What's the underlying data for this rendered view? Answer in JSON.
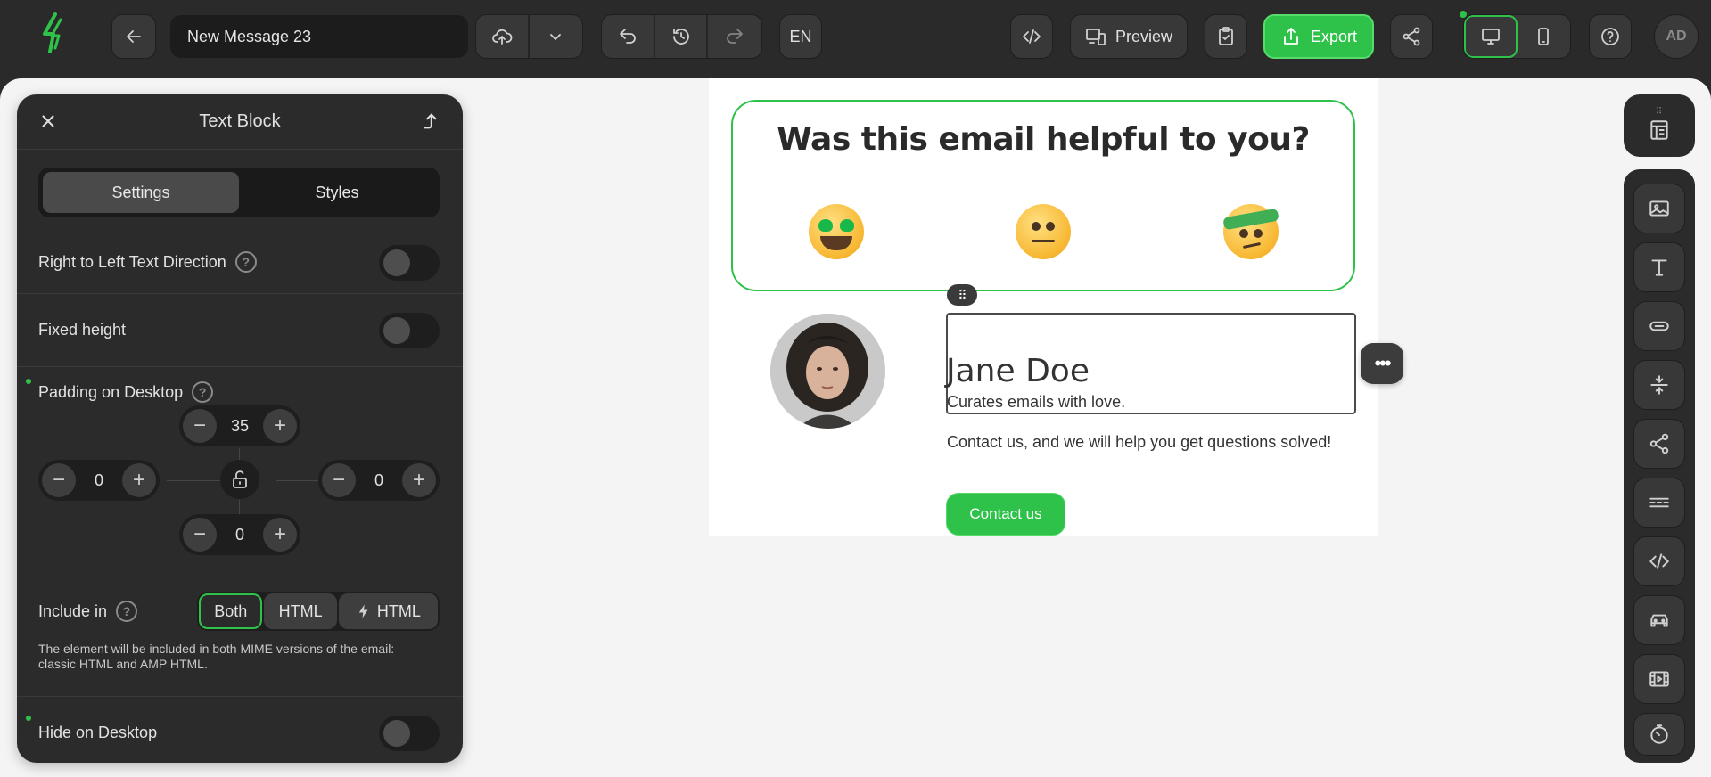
{
  "toolbar": {
    "message_title": "New Message 23",
    "language": "EN",
    "preview_label": "Preview",
    "export_label": "Export",
    "user_initials": "AD"
  },
  "panel": {
    "title": "Text Block",
    "tabs": [
      "Settings",
      "Styles"
    ],
    "active_tab": "Settings",
    "rtl_label": "Right to Left Text Direction",
    "fixed_height_label": "Fixed height",
    "padding_label": "Padding on Desktop",
    "padding": {
      "top": "35",
      "left": "0",
      "right": "0",
      "bottom": "0"
    },
    "include_label": "Include in",
    "include_options": [
      "Both",
      "HTML",
      "HTML"
    ],
    "include_selected": "Both",
    "include_note": "The element will be included in both MIME versions of the email: classic HTML and AMP HTML.",
    "hide_desktop_label": "Hide on Desktop"
  },
  "email": {
    "question": "Was this email helpful to you?",
    "name": "Jane Doe",
    "tagline": "Curates emails with love.",
    "contact_text": "Contact us, and we will help you get questions solved!",
    "contact_button": "Contact us"
  },
  "colors": {
    "accent": "#2fc24a",
    "app_bg": "#2a2a2a",
    "workspace_bg": "#f4f4f4"
  }
}
